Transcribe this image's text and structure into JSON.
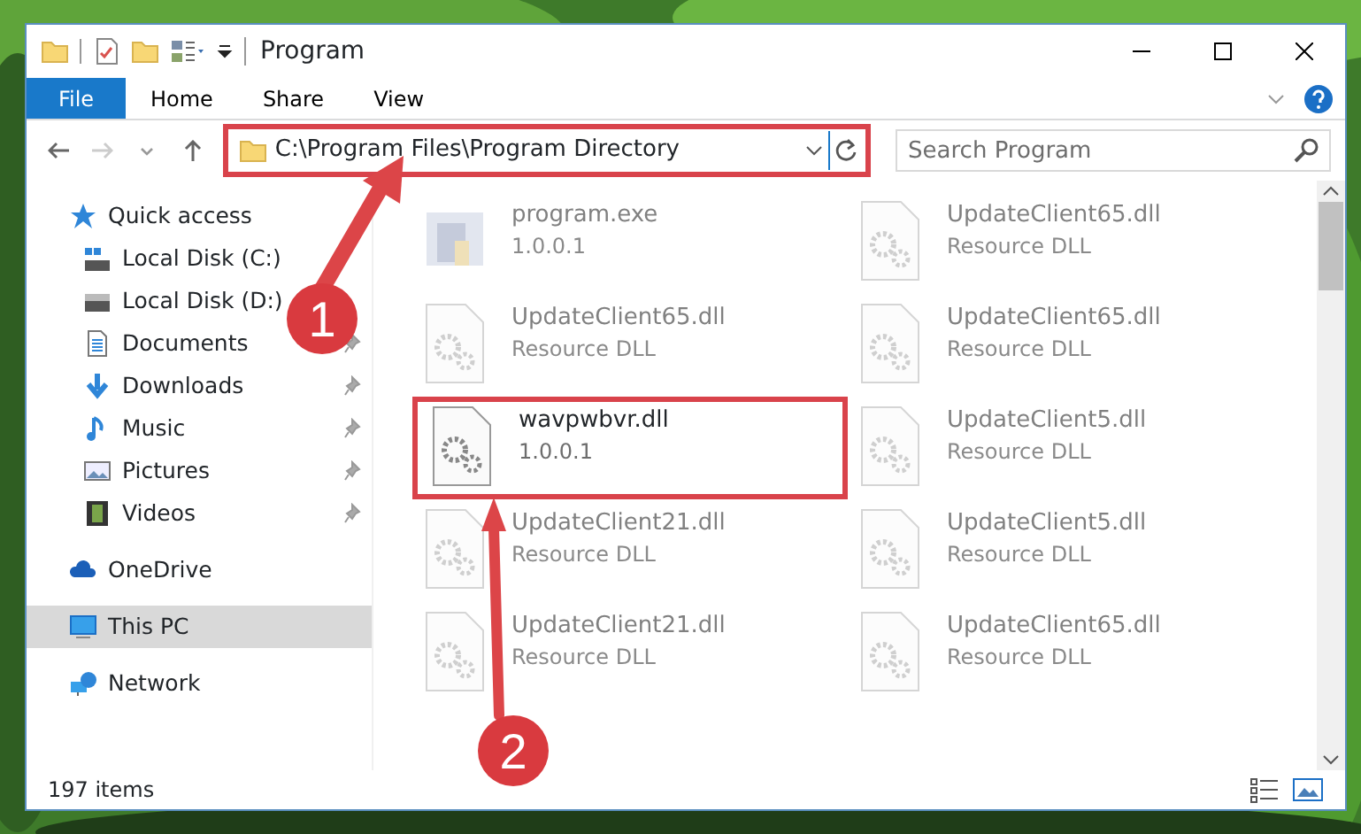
{
  "window": {
    "title": "Program"
  },
  "ribbon_tabs": [
    {
      "label": "File",
      "selected": true
    },
    {
      "label": "Home",
      "selected": false
    },
    {
      "label": "Share",
      "selected": false
    },
    {
      "label": "View",
      "selected": false
    }
  ],
  "address": {
    "path": "C:\\Program Files\\Program Directory",
    "outlined": true
  },
  "search": {
    "placeholder": "Search Program"
  },
  "nav": [
    {
      "label": "Quick access",
      "kind": "star",
      "selected": false,
      "children": [
        {
          "label": "Local Disk (C:)",
          "kind": "disk-c",
          "pinned": false
        },
        {
          "label": "Local Disk (D:)",
          "kind": "disk",
          "pinned": false
        },
        {
          "label": "Documents",
          "kind": "documents",
          "pinned": true
        },
        {
          "label": "Downloads",
          "kind": "downloads",
          "pinned": true
        },
        {
          "label": "Music",
          "kind": "music",
          "pinned": true
        },
        {
          "label": "Pictures",
          "kind": "pictures",
          "pinned": true
        },
        {
          "label": "Videos",
          "kind": "videos",
          "pinned": true
        }
      ]
    },
    {
      "label": "OneDrive",
      "kind": "cloud",
      "selected": false
    },
    {
      "label": "This PC",
      "kind": "pc",
      "selected": true
    },
    {
      "label": "Network",
      "kind": "network",
      "selected": false
    }
  ],
  "files": [
    {
      "name": "program.exe",
      "detail": "1.0.0.1",
      "kind": "exe",
      "faded": true,
      "outlined": false
    },
    {
      "name": "UpdateClient65.dll",
      "detail": "Resource DLL",
      "kind": "dll",
      "faded": true,
      "outlined": false
    },
    {
      "name": "UpdateClient65.dll",
      "detail": "Resource DLL",
      "kind": "dll",
      "faded": true,
      "outlined": false
    },
    {
      "name": "UpdateClient65.dll",
      "detail": "Resource DLL",
      "kind": "dll",
      "faded": true,
      "outlined": false
    },
    {
      "name": "wavpwbvr.dll",
      "detail": "1.0.0.1",
      "kind": "dll",
      "faded": false,
      "outlined": true
    },
    {
      "name": "UpdateClient5.dll",
      "detail": "Resource DLL",
      "kind": "dll",
      "faded": true,
      "outlined": false
    },
    {
      "name": "UpdateClient21.dll",
      "detail": "Resource DLL",
      "kind": "dll",
      "faded": true,
      "outlined": false
    },
    {
      "name": "UpdateClient5.dll",
      "detail": "Resource DLL",
      "kind": "dll",
      "faded": true,
      "outlined": false
    },
    {
      "name": "UpdateClient21.dll",
      "detail": "Resource DLL",
      "kind": "dll",
      "faded": true,
      "outlined": false
    },
    {
      "name": "UpdateClient65.dll",
      "detail": "Resource DLL",
      "kind": "dll",
      "faded": true,
      "outlined": false
    }
  ],
  "status_bar": {
    "count": "197 items"
  },
  "annotations": [
    {
      "number": "1"
    },
    {
      "number": "2"
    }
  ]
}
